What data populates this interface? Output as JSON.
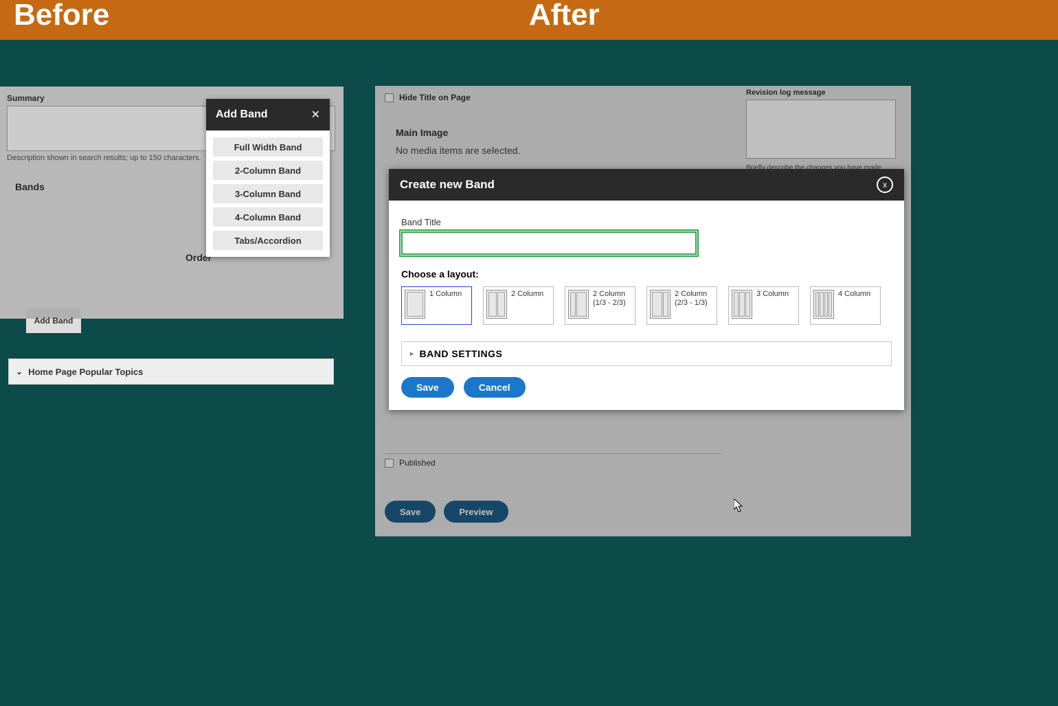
{
  "header": {
    "before": "Before",
    "after": "After"
  },
  "before": {
    "summary_label": "Summary",
    "summary_hint": "Description shown in search results; up to 150 characters.",
    "bands_label": "Bands",
    "order_label": "Order",
    "add_band_button": "Add Band",
    "accordion_label": "Home Page Popular Topics",
    "menu": {
      "title": "Add Band",
      "items": [
        "Full Width Band",
        "2-Column Band",
        "3-Column Band",
        "4-Column Band",
        "Tabs/Accordion"
      ]
    }
  },
  "after": {
    "hide_title": "Hide Title on Page",
    "main_image_label": "Main Image",
    "no_media": "No media items are selected.",
    "published": "Published",
    "save": "Save",
    "preview": "Preview",
    "revision": {
      "label": "Revision log message",
      "hint": "Briefly describe the changes you have made."
    },
    "modal": {
      "title": "Create new Band",
      "band_title_label": "Band Title",
      "band_title_value": "",
      "choose_layout_label": "Choose a layout:",
      "layouts": [
        {
          "name": "1 Column",
          "selected": true
        },
        {
          "name": "2 Column"
        },
        {
          "name": "2 Column (1/3 - 2/3)"
        },
        {
          "name": "2 Column (2/3 - 1/3)"
        },
        {
          "name": "3 Column"
        },
        {
          "name": "4 Column"
        }
      ],
      "band_settings": "BAND SETTINGS",
      "save": "Save",
      "cancel": "Cancel"
    }
  }
}
